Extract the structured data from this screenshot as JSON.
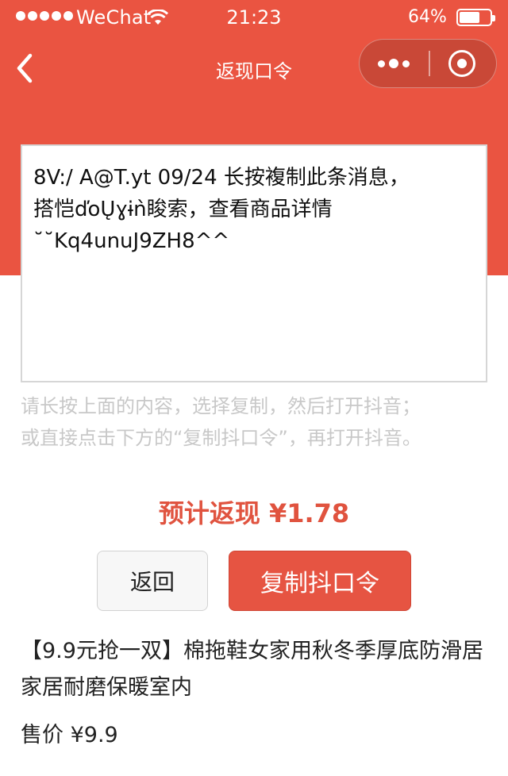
{
  "status_bar": {
    "carrier": "WeChat",
    "time": "21:23",
    "battery_percent": "64%",
    "battery_level": 0.64,
    "signal_bars": 5
  },
  "nav": {
    "title": "返现口令",
    "back_icon": "chevron-left-icon",
    "more_icon": "more-dots-icon",
    "close_icon": "target-circle-icon"
  },
  "colors": {
    "brand": "#ea5441",
    "accent_text": "#e0533f",
    "hint_text": "#c8c8c8"
  },
  "code_text": "8V:/ A@T.yt 09/24 长按複制此条消息，\n搭恺ďoŲɣɨǹ睃索，查看商品详情\n˘˘Kq4unuJ9ZH8^^",
  "hint": {
    "line1": "请长按上面的内容，选择复制，然后打开抖音；",
    "line2": "或直接点击下方的“复制抖口令”，再打开抖音。"
  },
  "cashback_label": "预计返现 ¥1.78",
  "buttons": {
    "back_label": "返回",
    "copy_label": "复制抖口令"
  },
  "product": {
    "title": "【9.9元抢一双】棉拖鞋女家用秋冬季厚底防滑居家居耐磨保暖室内",
    "price": "售价 ¥9.9"
  }
}
